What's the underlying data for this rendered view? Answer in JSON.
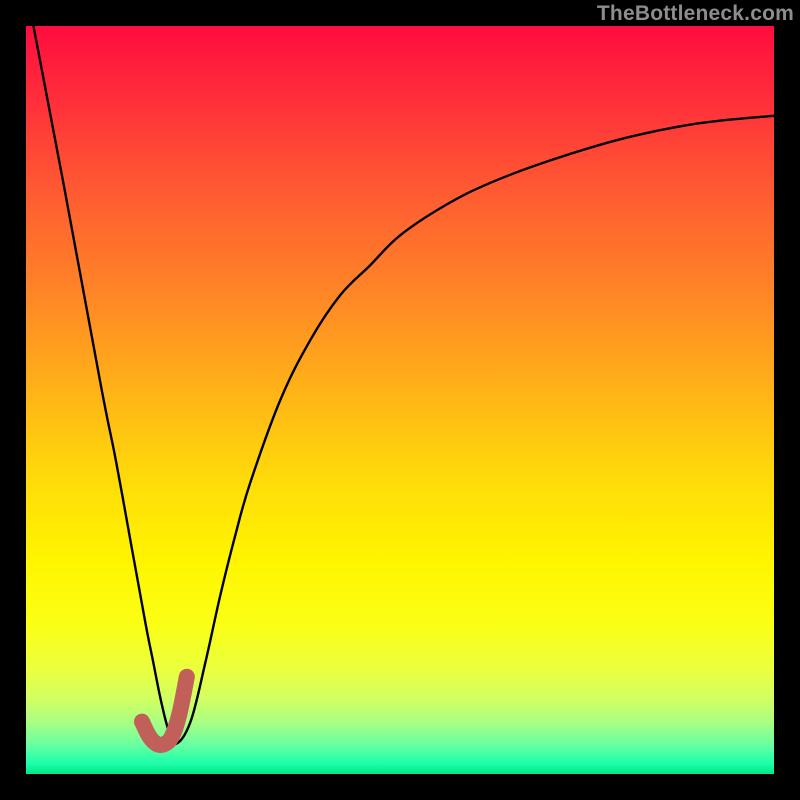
{
  "watermark": "TheBottleneck.com",
  "chart_data": {
    "type": "line",
    "title": "",
    "xlabel": "",
    "ylabel": "",
    "xlim": [
      0,
      100
    ],
    "ylim": [
      0,
      100
    ],
    "annotations": [],
    "series": [
      {
        "name": "bottleneck-curve",
        "color": "#000000",
        "x": [
          1,
          5,
          10,
          12,
          14,
          16,
          17,
          18,
          19,
          20,
          22,
          24,
          26,
          28,
          30,
          34,
          38,
          42,
          46,
          50,
          56,
          62,
          70,
          80,
          90,
          100
        ],
        "y": [
          100,
          79,
          52,
          42,
          31,
          20,
          15,
          10,
          6,
          4,
          7,
          15,
          24,
          32,
          39,
          50,
          58,
          64,
          68,
          72,
          76,
          79,
          82,
          85,
          87,
          88
        ]
      },
      {
        "name": "highlight-segment",
        "color": "#c06058",
        "x": [
          15.5,
          16.5,
          17.5,
          18.5,
          19.5,
          20.5,
          21.5
        ],
        "y": [
          7,
          5,
          4,
          4,
          5,
          8,
          13
        ]
      }
    ],
    "gradient_stops": [
      {
        "offset": 0.0,
        "color": "#ff0c3e"
      },
      {
        "offset": 0.1,
        "color": "#ff2f3a"
      },
      {
        "offset": 0.22,
        "color": "#ff5a32"
      },
      {
        "offset": 0.35,
        "color": "#ff8327"
      },
      {
        "offset": 0.5,
        "color": "#ffb716"
      },
      {
        "offset": 0.62,
        "color": "#ffdf08"
      },
      {
        "offset": 0.72,
        "color": "#fff600"
      },
      {
        "offset": 0.8,
        "color": "#fbff15"
      },
      {
        "offset": 0.86,
        "color": "#eaff3e"
      },
      {
        "offset": 0.9,
        "color": "#d1ff62"
      },
      {
        "offset": 0.93,
        "color": "#aaff82"
      },
      {
        "offset": 0.96,
        "color": "#6bffa0"
      },
      {
        "offset": 0.985,
        "color": "#1fffad"
      },
      {
        "offset": 1.0,
        "color": "#00e887"
      }
    ]
  }
}
